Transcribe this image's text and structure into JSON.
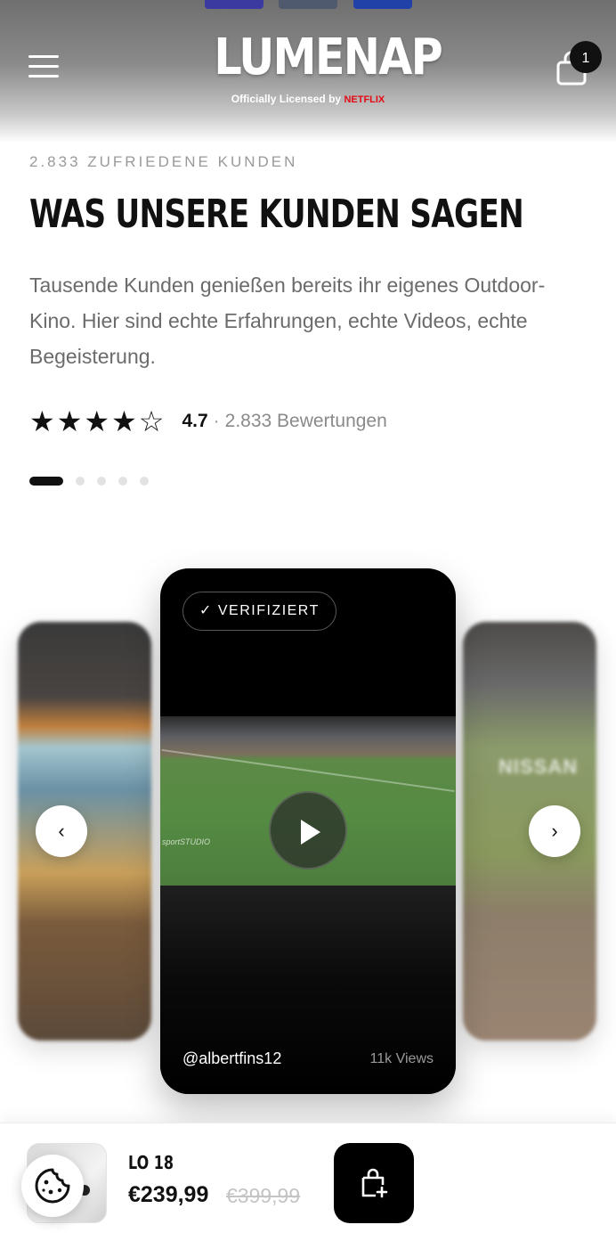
{
  "header": {
    "logo_text": "LUMENAP",
    "logo_sub": "Officially Licensed by",
    "logo_partner": "NETFLIX",
    "cart_count": "1"
  },
  "intro": {
    "eyebrow": "2.833 ZUFRIEDENE KUNDEN",
    "headline": "WAS UNSERE KUNDEN SAGEN",
    "description": "Tausende Kunden genießen bereits ihr eigenes Outdoor-Kino. Hier sind echte Erfahrungen, echte Videos, echte Begeisterung.",
    "stars": "★★★★☆",
    "rating_value": "4.7",
    "rating_separator": "·",
    "rating_count": "2.833 Bewertungen"
  },
  "carousel": {
    "total_slides": 5,
    "active_slide": 1,
    "current": {
      "badge": "✓ VERIFIZIERT",
      "handle": "@albertfins12",
      "views": "11k Views",
      "video_watermark": "sportSTUDIO"
    },
    "side_right_text": "NISSAN",
    "prev_icon": "‹",
    "next_icon": "›"
  },
  "sticky_bar": {
    "product_name": "LO 18",
    "price": "€239,99",
    "old_price": "€399,99"
  },
  "colors": {
    "accent": "#111111",
    "netflix_red": "#e50914",
    "muted_text": "#6b6b6b"
  }
}
